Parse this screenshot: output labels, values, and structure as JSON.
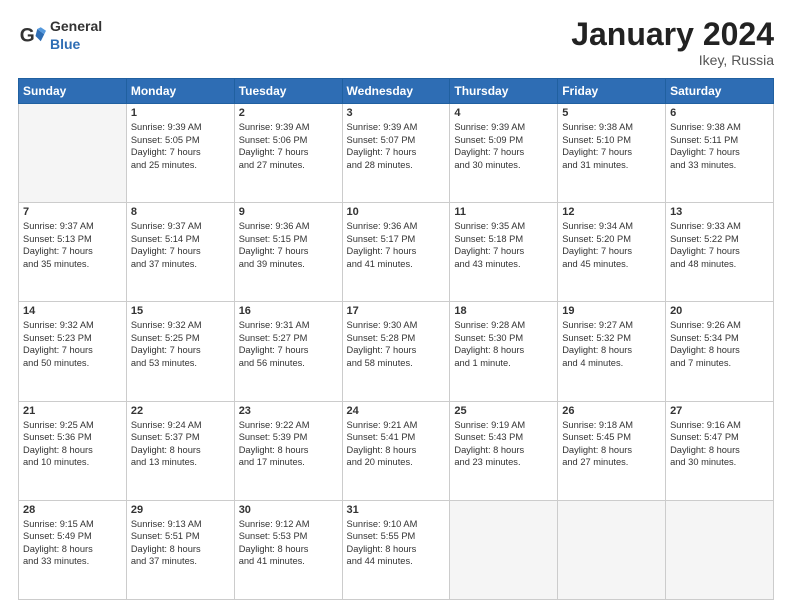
{
  "header": {
    "logo_general": "General",
    "logo_blue": "Blue",
    "title": "January 2024",
    "location": "Ikey, Russia"
  },
  "days_of_week": [
    "Sunday",
    "Monday",
    "Tuesday",
    "Wednesday",
    "Thursday",
    "Friday",
    "Saturday"
  ],
  "weeks": [
    [
      {
        "day": "",
        "data": ""
      },
      {
        "day": "1",
        "data": "Sunrise: 9:39 AM\nSunset: 5:05 PM\nDaylight: 7 hours\nand 25 minutes."
      },
      {
        "day": "2",
        "data": "Sunrise: 9:39 AM\nSunset: 5:06 PM\nDaylight: 7 hours\nand 27 minutes."
      },
      {
        "day": "3",
        "data": "Sunrise: 9:39 AM\nSunset: 5:07 PM\nDaylight: 7 hours\nand 28 minutes."
      },
      {
        "day": "4",
        "data": "Sunrise: 9:39 AM\nSunset: 5:09 PM\nDaylight: 7 hours\nand 30 minutes."
      },
      {
        "day": "5",
        "data": "Sunrise: 9:38 AM\nSunset: 5:10 PM\nDaylight: 7 hours\nand 31 minutes."
      },
      {
        "day": "6",
        "data": "Sunrise: 9:38 AM\nSunset: 5:11 PM\nDaylight: 7 hours\nand 33 minutes."
      }
    ],
    [
      {
        "day": "7",
        "data": "Sunrise: 9:37 AM\nSunset: 5:13 PM\nDaylight: 7 hours\nand 35 minutes."
      },
      {
        "day": "8",
        "data": "Sunrise: 9:37 AM\nSunset: 5:14 PM\nDaylight: 7 hours\nand 37 minutes."
      },
      {
        "day": "9",
        "data": "Sunrise: 9:36 AM\nSunset: 5:15 PM\nDaylight: 7 hours\nand 39 minutes."
      },
      {
        "day": "10",
        "data": "Sunrise: 9:36 AM\nSunset: 5:17 PM\nDaylight: 7 hours\nand 41 minutes."
      },
      {
        "day": "11",
        "data": "Sunrise: 9:35 AM\nSunset: 5:18 PM\nDaylight: 7 hours\nand 43 minutes."
      },
      {
        "day": "12",
        "data": "Sunrise: 9:34 AM\nSunset: 5:20 PM\nDaylight: 7 hours\nand 45 minutes."
      },
      {
        "day": "13",
        "data": "Sunrise: 9:33 AM\nSunset: 5:22 PM\nDaylight: 7 hours\nand 48 minutes."
      }
    ],
    [
      {
        "day": "14",
        "data": "Sunrise: 9:32 AM\nSunset: 5:23 PM\nDaylight: 7 hours\nand 50 minutes."
      },
      {
        "day": "15",
        "data": "Sunrise: 9:32 AM\nSunset: 5:25 PM\nDaylight: 7 hours\nand 53 minutes."
      },
      {
        "day": "16",
        "data": "Sunrise: 9:31 AM\nSunset: 5:27 PM\nDaylight: 7 hours\nand 56 minutes."
      },
      {
        "day": "17",
        "data": "Sunrise: 9:30 AM\nSunset: 5:28 PM\nDaylight: 7 hours\nand 58 minutes."
      },
      {
        "day": "18",
        "data": "Sunrise: 9:28 AM\nSunset: 5:30 PM\nDaylight: 8 hours\nand 1 minute."
      },
      {
        "day": "19",
        "data": "Sunrise: 9:27 AM\nSunset: 5:32 PM\nDaylight: 8 hours\nand 4 minutes."
      },
      {
        "day": "20",
        "data": "Sunrise: 9:26 AM\nSunset: 5:34 PM\nDaylight: 8 hours\nand 7 minutes."
      }
    ],
    [
      {
        "day": "21",
        "data": "Sunrise: 9:25 AM\nSunset: 5:36 PM\nDaylight: 8 hours\nand 10 minutes."
      },
      {
        "day": "22",
        "data": "Sunrise: 9:24 AM\nSunset: 5:37 PM\nDaylight: 8 hours\nand 13 minutes."
      },
      {
        "day": "23",
        "data": "Sunrise: 9:22 AM\nSunset: 5:39 PM\nDaylight: 8 hours\nand 17 minutes."
      },
      {
        "day": "24",
        "data": "Sunrise: 9:21 AM\nSunset: 5:41 PM\nDaylight: 8 hours\nand 20 minutes."
      },
      {
        "day": "25",
        "data": "Sunrise: 9:19 AM\nSunset: 5:43 PM\nDaylight: 8 hours\nand 23 minutes."
      },
      {
        "day": "26",
        "data": "Sunrise: 9:18 AM\nSunset: 5:45 PM\nDaylight: 8 hours\nand 27 minutes."
      },
      {
        "day": "27",
        "data": "Sunrise: 9:16 AM\nSunset: 5:47 PM\nDaylight: 8 hours\nand 30 minutes."
      }
    ],
    [
      {
        "day": "28",
        "data": "Sunrise: 9:15 AM\nSunset: 5:49 PM\nDaylight: 8 hours\nand 33 minutes."
      },
      {
        "day": "29",
        "data": "Sunrise: 9:13 AM\nSunset: 5:51 PM\nDaylight: 8 hours\nand 37 minutes."
      },
      {
        "day": "30",
        "data": "Sunrise: 9:12 AM\nSunset: 5:53 PM\nDaylight: 8 hours\nand 41 minutes."
      },
      {
        "day": "31",
        "data": "Sunrise: 9:10 AM\nSunset: 5:55 PM\nDaylight: 8 hours\nand 44 minutes."
      },
      {
        "day": "",
        "data": ""
      },
      {
        "day": "",
        "data": ""
      },
      {
        "day": "",
        "data": ""
      }
    ]
  ]
}
